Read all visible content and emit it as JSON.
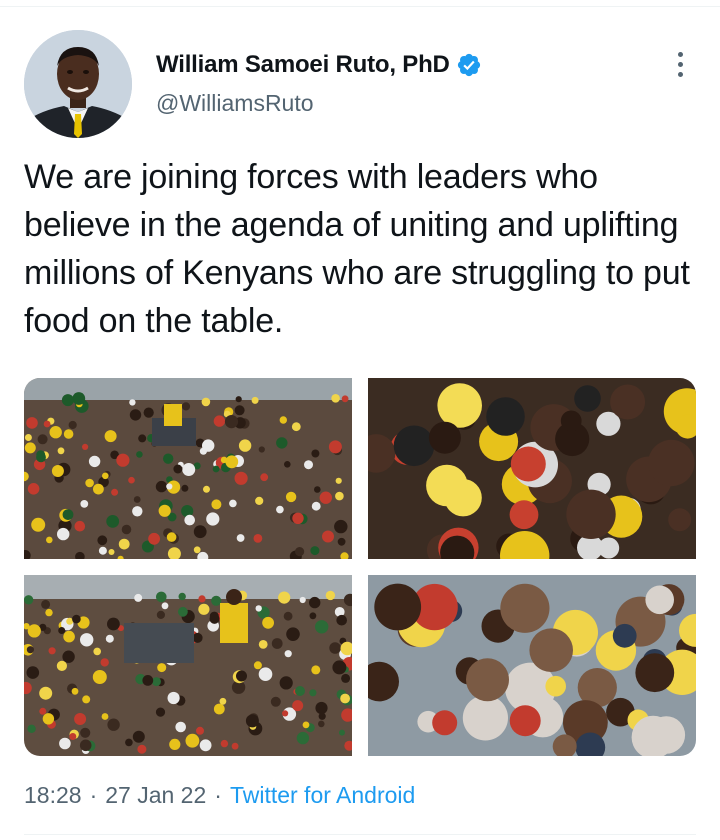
{
  "author": {
    "display_name": "William Samoei Ruto, PhD",
    "handle": "@WilliamsRuto",
    "verified": true,
    "avatar_icon": "profile-photo"
  },
  "tweet": {
    "text": "We are joining forces with leaders who believe in the agenda of uniting and uplifting millions of Kenyans who are struggling to put food on the table."
  },
  "media": {
    "count": 4,
    "photos": [
      {
        "name": "rally-crowd-aerial"
      },
      {
        "name": "crowd-closeup-yellow-caps"
      },
      {
        "name": "leader-on-vehicle-crowd"
      },
      {
        "name": "crowd-closeup-cheering"
      }
    ]
  },
  "meta": {
    "time": "18:28",
    "separator": "·",
    "date": "27 Jan 22",
    "source": "Twitter for Android"
  },
  "colors": {
    "text": "#0f1419",
    "secondary": "#536471",
    "accent": "#1d9bf0",
    "divider": "#eff3f4"
  },
  "icons": {
    "verified": "verified-badge-icon",
    "more": "more-options-icon"
  }
}
